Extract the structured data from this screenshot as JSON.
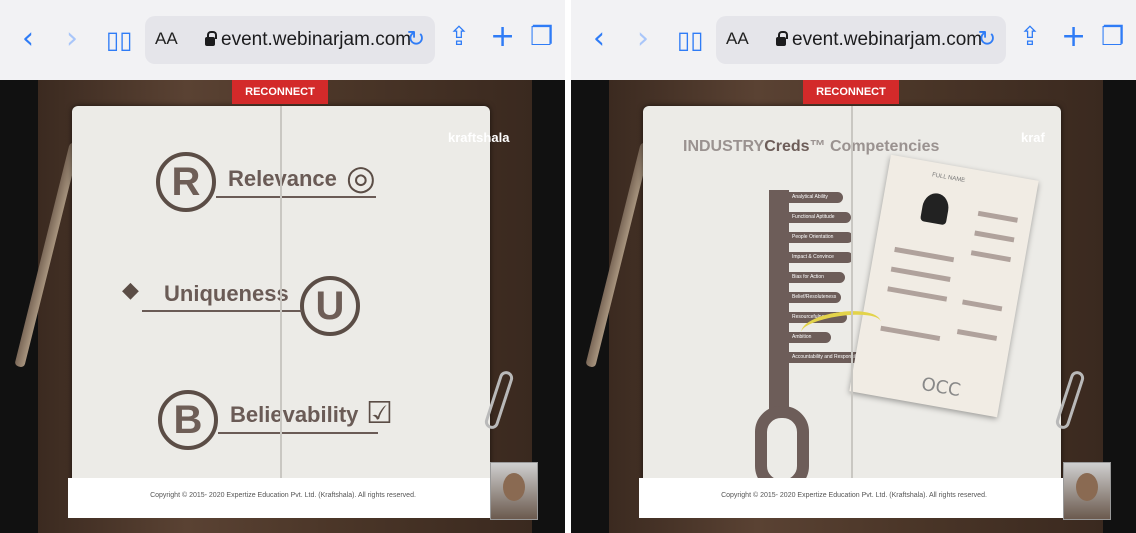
{
  "panes": [
    {
      "toolbar": {
        "back_icon": "chevron-left-icon",
        "forward_icon": "chevron-right-icon",
        "bookmarks_icon": "book-icon",
        "text_size_label": "AA",
        "url": "event.webinarjam.com",
        "reload_icon": "reload-icon",
        "share_icon": "share-icon",
        "new_tab_icon": "plus-icon",
        "tabs_icon": "tabs-icon"
      },
      "video": {
        "reconnect": "RECONNECT",
        "brand": "kraftshala",
        "copyright": "Copyright © 2015- 2020 Expertize Education Pvt. Ltd. (Kraftshala). All rights reserved.",
        "slide": {
          "rows": [
            {
              "letter": "R",
              "word": "Relevance",
              "icon": "target-icon"
            },
            {
              "letter": "U",
              "word": "Uniqueness",
              "icon": "diamond-icon"
            },
            {
              "letter": "B",
              "word": "Believability",
              "icon": "checkmark-icon"
            }
          ]
        }
      }
    },
    {
      "toolbar": {
        "back_icon": "chevron-left-icon",
        "forward_icon": "chevron-right-icon",
        "bookmarks_icon": "book-icon",
        "text_size_label": "AA",
        "url": "event.webinarjam.com",
        "reload_icon": "reload-icon",
        "share_icon": "share-icon",
        "new_tab_icon": "plus-icon",
        "tabs_icon": "tabs-icon"
      },
      "video": {
        "reconnect": "RECONNECT",
        "brand": "kraf",
        "copyright": "Copyright © 2015- 2020 Expertize Education Pvt. Ltd. (Kraftshala). All rights reserved.",
        "slide": {
          "title_prefix": "INDUSTRY",
          "title_bold": "Creds",
          "title_suffix": "™ Competencies",
          "competencies": [
            "Analytical Ability",
            "Functional Aptitude",
            "People Orientation",
            "Impact & Convince",
            "Bias for Action",
            "Belief/Resoluteness",
            "Resourcefulness",
            "Ambition",
            "Accountability and Responsibility"
          ],
          "resume_heading": "FULL NAME",
          "resume_footer_mark": "OCC"
        }
      }
    }
  ],
  "colors": {
    "accent": "#2f7cf6",
    "reconnect": "#d32a2a",
    "slide_ink": "#6a5b56"
  }
}
